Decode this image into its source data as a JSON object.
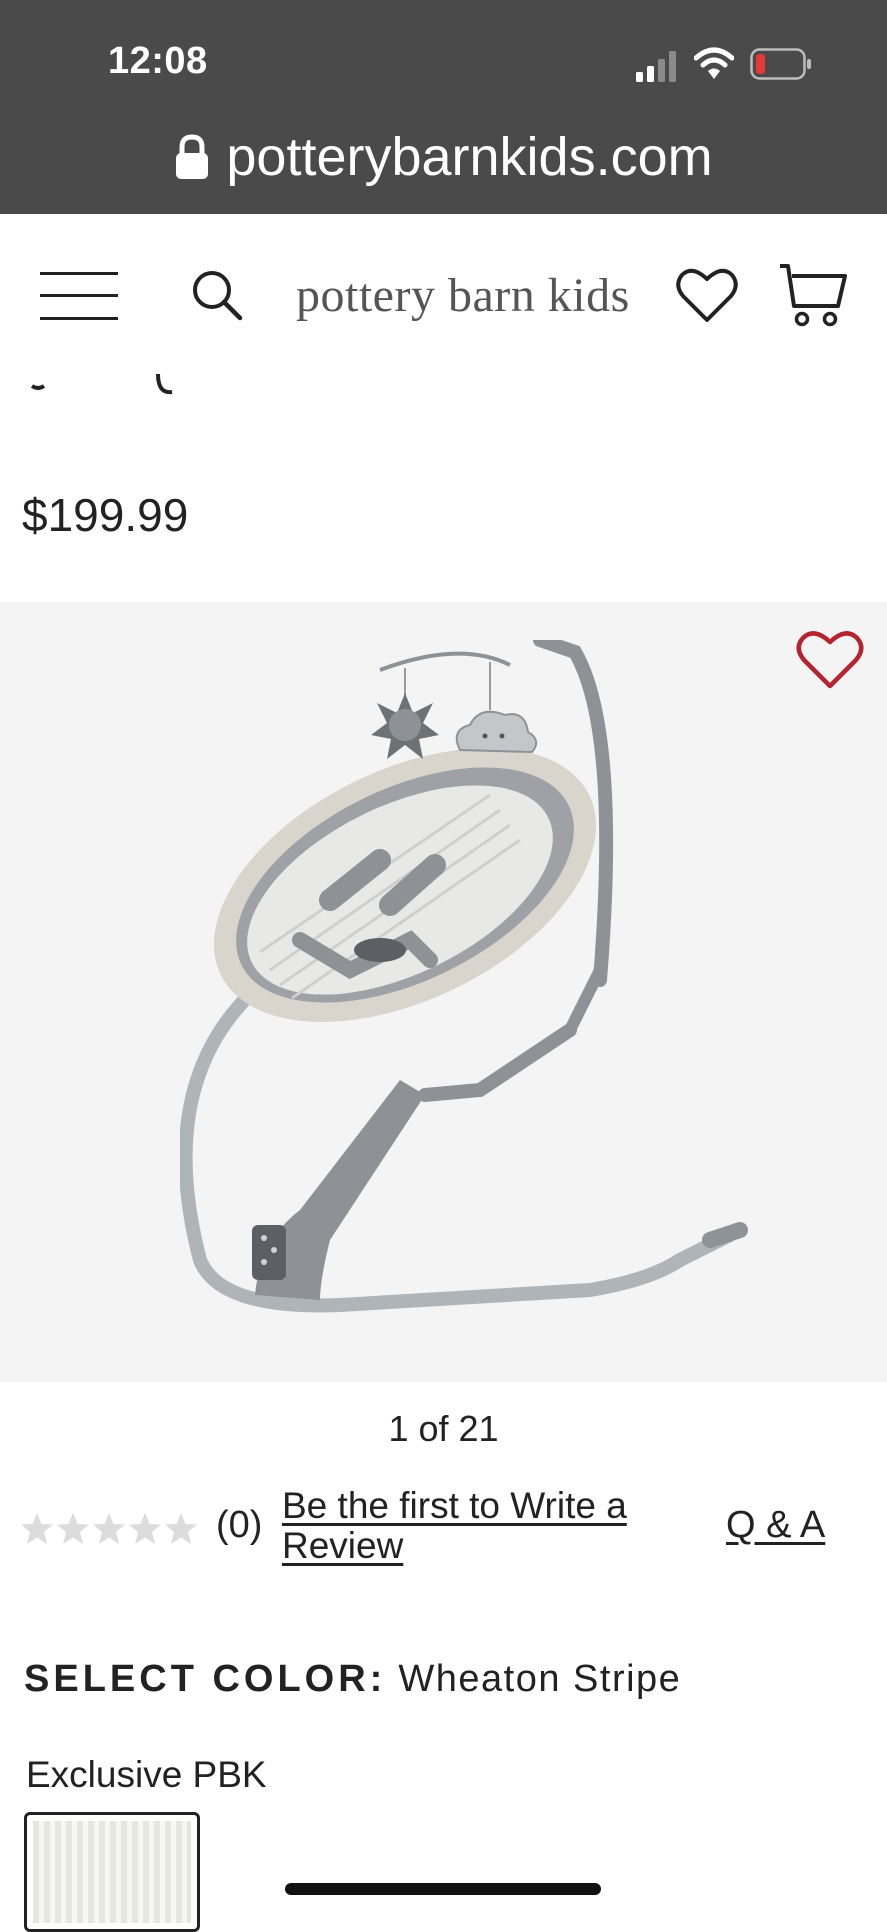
{
  "status_bar": {
    "time": "12:08"
  },
  "browser": {
    "url": "potterybarnkids.com"
  },
  "header": {
    "brand": "pottery barn kids"
  },
  "product": {
    "price": "$199.99"
  },
  "gallery": {
    "counter": "1 of 21"
  },
  "reviews": {
    "rating": 0,
    "max_rating": 5,
    "count": "(0)",
    "write_review_link": "Be the first to Write a Review",
    "qa_link": "Q & A"
  },
  "color_selection": {
    "label": "SELECT COLOR:",
    "value": "Wheaton Stripe",
    "group_label": "Exclusive PBK"
  },
  "colors": {
    "status_bar_bg": "#4a4a4a",
    "battery_low": "#e53935",
    "favorite_red": "#b5232f",
    "gallery_bg": "#f4f4f4"
  }
}
